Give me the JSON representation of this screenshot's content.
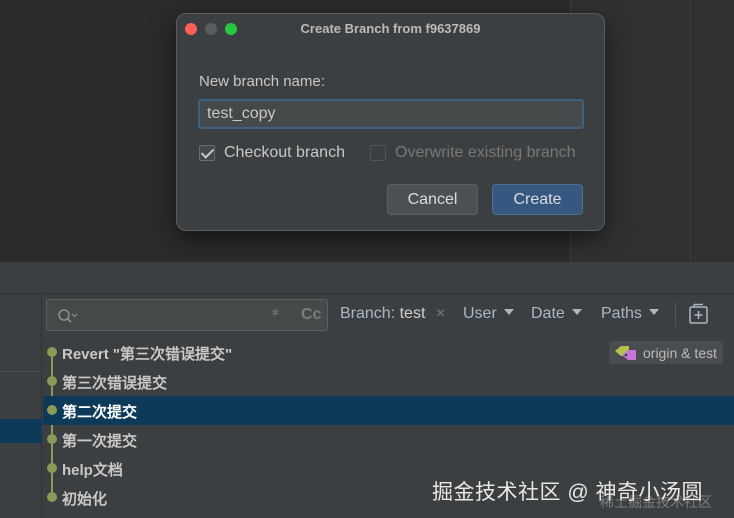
{
  "dialog": {
    "title": "Create Branch from f9637869",
    "field_label": "New branch name:",
    "branch_name": "test_copy",
    "checkout_label": "Checkout branch",
    "checkout_checked": true,
    "overwrite_label": "Overwrite existing branch",
    "overwrite_checked": false,
    "cancel_label": "Cancel",
    "create_label": "Create"
  },
  "filter_bar": {
    "search_value": "",
    "regex_glyph": "*",
    "case_glyph": "Cc",
    "branch_label": "Branch:",
    "branch_value": "test",
    "branch_clear": "×",
    "user_label": "User",
    "date_label": "Date",
    "paths_label": "Paths"
  },
  "commits": [
    {
      "message": "Revert \"第三次错误提交\"",
      "refs": "origin & test"
    },
    {
      "message": "第三次错误提交"
    },
    {
      "message": "第二次提交",
      "selected": true
    },
    {
      "message": "第一次提交"
    },
    {
      "message": "help文档"
    },
    {
      "message": "初始化"
    }
  ],
  "watermark": {
    "text": "掘金技术社区 @ 神奇小汤圆",
    "sub": "稀土掘金技术社区"
  },
  "colors": {
    "accent": "#365880",
    "selection": "#0d3a58",
    "graph": "#8a9a58"
  }
}
